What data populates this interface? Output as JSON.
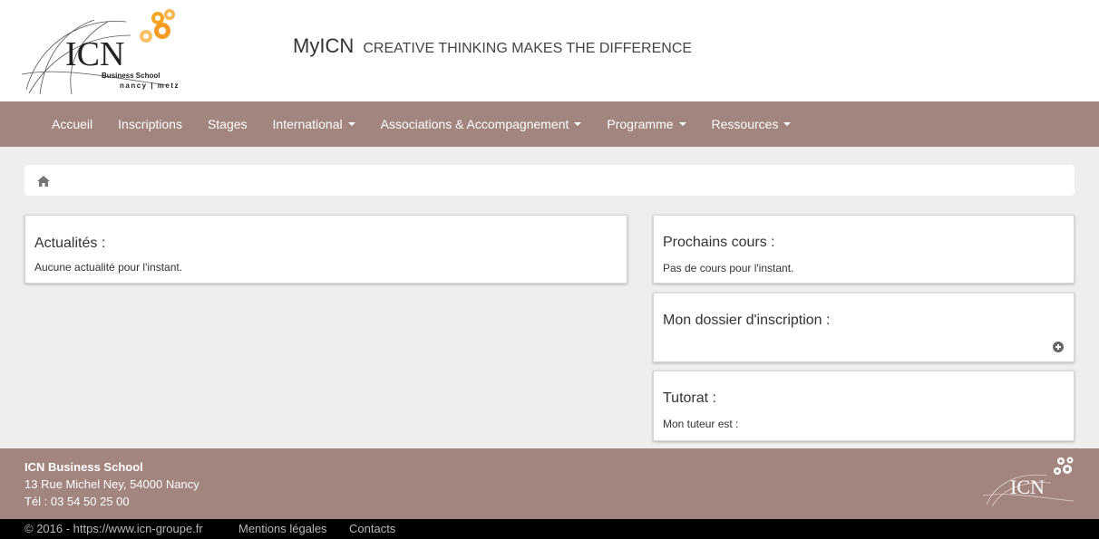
{
  "header": {
    "logo": {
      "text": "ICN",
      "subtitle": "Business School",
      "cities": "nancy | metz"
    },
    "brand": "MyICN",
    "slogan": "CREATIVE THINKING MAKES THE DIFFERENCE"
  },
  "nav": {
    "items": [
      {
        "label": "Accueil"
      },
      {
        "label": "Inscriptions"
      },
      {
        "label": "Stages"
      },
      {
        "label": "International"
      },
      {
        "label": "Associations & Accompagnement"
      },
      {
        "label": "Programme"
      },
      {
        "label": "Ressources"
      }
    ]
  },
  "breadcrumb": {
    "icon": "home-icon"
  },
  "panels": {
    "actualites": {
      "title": "Actualités :",
      "text": "Aucune actualité pour l'instant."
    },
    "cours": {
      "title": "Prochains cours :",
      "text": "Pas de cours pour l'instant."
    },
    "dossier": {
      "title": "Mon dossier d'inscription :",
      "icon": "plus-circle-icon"
    },
    "tutorat": {
      "title": "Tutorat :",
      "text": "Mon tuteur est :"
    }
  },
  "footer": {
    "name": "ICN Business School",
    "address": "13 Rue Michel Ney, 54000 Nancy",
    "phone": "Tél : 03 54 50 25 00",
    "logo_text": "ICN"
  },
  "bottombar": {
    "copyright": "© 2016 - https://www.icn-groupe.fr",
    "legal": "Mentions légales",
    "contacts": "Contacts"
  },
  "colors": {
    "nav_bg": "#a3857f",
    "accent_orange": "#f5a623",
    "page_bg": "#eeeeee"
  }
}
